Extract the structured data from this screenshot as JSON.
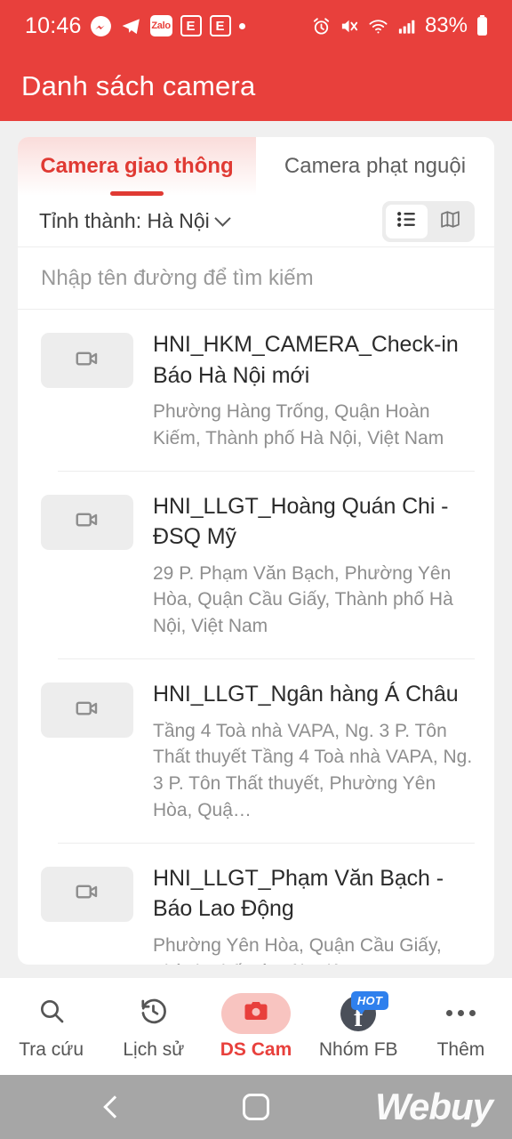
{
  "status_bar": {
    "time": "10:46",
    "battery_text": "83%",
    "left_icons": [
      "messenger-icon",
      "telegram-icon",
      "zalo-icon",
      "e-app-icon",
      "e-app-icon-2",
      "dot-icon"
    ],
    "right_icons": [
      "alarm-icon",
      "mute-icon",
      "wifi-icon",
      "signal-icon",
      "battery-icon"
    ],
    "app_letter": "E",
    "zalo_letter": "Zalo",
    "bg_color": "#e8403c"
  },
  "header": {
    "title": "Danh sách camera",
    "bg_color": "#e8403c"
  },
  "tabs": [
    {
      "label": "Camera giao thông",
      "active": true
    },
    {
      "label": "Camera phạt nguội",
      "active": false
    }
  ],
  "filter": {
    "province_label": "Tỉnh thành: Hà Nội",
    "chevron": "chevron-down-icon",
    "view_modes": [
      {
        "name": "list-view",
        "icon": "list-icon",
        "selected": true
      },
      {
        "name": "map-view",
        "icon": "map-icon",
        "selected": false
      }
    ]
  },
  "search": {
    "placeholder": "Nhập tên đường để tìm kiếm",
    "value": ""
  },
  "camera_list": [
    {
      "title": "HNI_HKM_CAMERA_Check-in Báo Hà Nội mới",
      "address": "Phường Hàng Trống, Quận Hoàn Kiếm, Thành phố Hà Nội, Việt Nam"
    },
    {
      "title": "HNI_LLGT_Hoàng Quán Chi - ĐSQ Mỹ",
      "address": "29 P. Phạm Văn Bạch, Phường Yên Hòa, Quận Cầu Giấy, Thành phố Hà Nội, Việt Nam"
    },
    {
      "title": "HNI_LLGT_Ngân hàng Á Châu",
      "address": "Tầng 4 Toà nhà VAPA, Ng. 3 P. Tôn Thất thuyết Tầng 4 Toà nhà VAPA, Ng. 3 P. Tôn Thất thuyết, Phường Yên Hòa, Quậ…"
    },
    {
      "title": "HNI_LLGT_Phạm Văn Bạch - Báo Lao Động",
      "address": "Phường Yên Hòa, Quận Cầu Giấy, Thành phố Hà Nội, Việt Nam"
    }
  ],
  "bottom_nav": [
    {
      "label": "Tra cứu",
      "icon": "search-icon",
      "active": false
    },
    {
      "label": "Lịch sử",
      "icon": "history-icon",
      "active": false
    },
    {
      "label": "DS Cam",
      "icon": "camera-icon",
      "active": true
    },
    {
      "label": "Nhóm FB",
      "icon": "facebook-icon",
      "active": false,
      "badge": "HOT"
    },
    {
      "label": "Thêm",
      "icon": "more-dots-icon",
      "active": false
    }
  ],
  "system_nav": {
    "back": "back-icon",
    "home": "home-icon",
    "watermark": "Webuy"
  },
  "colors": {
    "brand_red": "#e8403c",
    "accent_pink": "#f8c4c0",
    "page_bg": "#f0f0f0"
  }
}
